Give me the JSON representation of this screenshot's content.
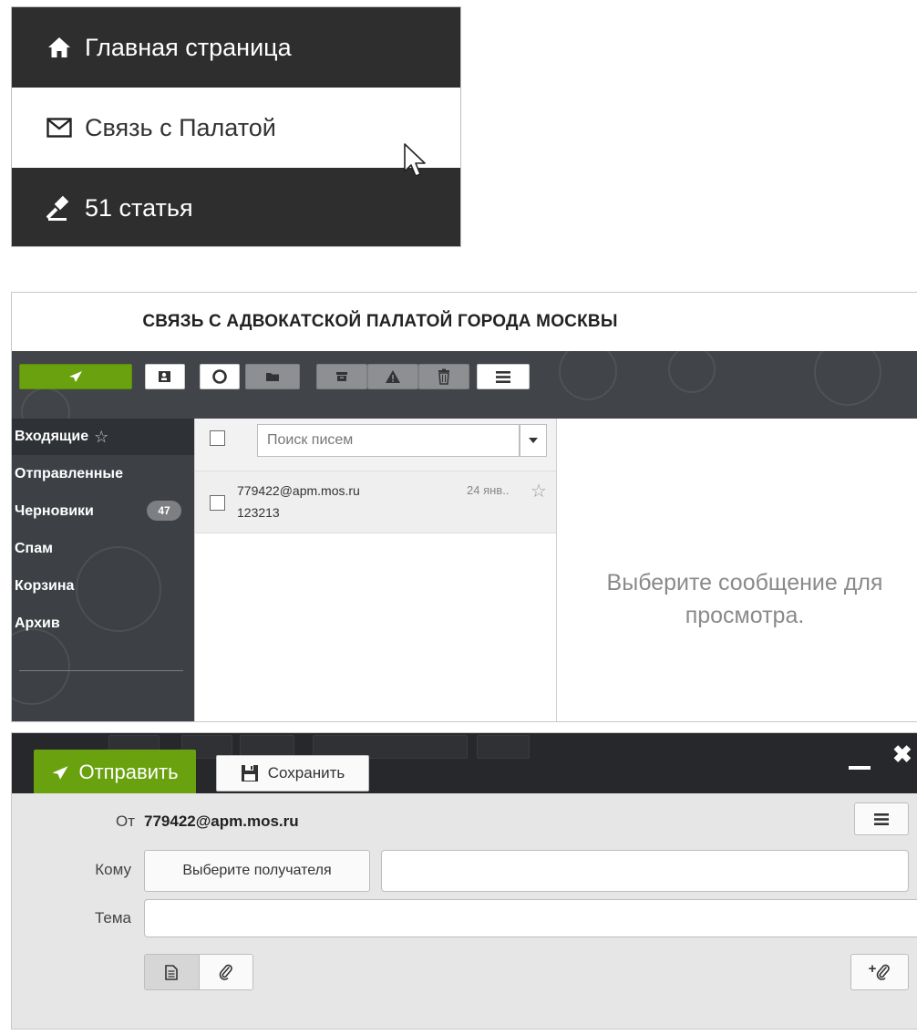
{
  "nav": {
    "items": [
      {
        "label": "Главная страница",
        "icon": "home-icon"
      },
      {
        "label": "Связь с Палатой",
        "icon": "envelope-icon"
      },
      {
        "label": "51 статья",
        "icon": "gavel-icon"
      }
    ]
  },
  "mail": {
    "title": "СВЯЗЬ С АДВОКАТСКОЙ ПАЛАТОЙ ГОРОДА МОСКВЫ",
    "toolbar": {
      "icons": [
        "send-icon",
        "contacts-icon",
        "refresh-icon",
        "folder-icon",
        "archive-icon",
        "spam-warning-icon",
        "trash-icon",
        "menu-icon"
      ]
    },
    "folders": [
      {
        "label": "Входящие",
        "active": true,
        "star": "☆"
      },
      {
        "label": "Отправленные"
      },
      {
        "label": "Черновики",
        "badge": "47"
      },
      {
        "label": "Спам"
      },
      {
        "label": "Корзина"
      },
      {
        "label": "Архив"
      }
    ],
    "search": {
      "placeholder": "Поиск писем"
    },
    "messages": [
      {
        "from": "779422@apm.mos.ru",
        "subject": "123213",
        "date": "24 янв..",
        "star": "☆"
      }
    ],
    "empty_state": {
      "line1": "Выберите сообщение для",
      "line2": "просмотра."
    }
  },
  "compose": {
    "send_label": "Отправить",
    "save_label": "Сохранить",
    "close_symbol": "✖",
    "from_label": "От",
    "from_value": "779422@apm.mos.ru",
    "to_label": "Кому",
    "recipient_button": "Выберите получателя",
    "subject_label": "Тема",
    "attach_plus": "+"
  },
  "colors": {
    "accent_green": "#6aa20f",
    "dark_nav": "#2e2e2e",
    "sidebar": "#3d4145"
  }
}
